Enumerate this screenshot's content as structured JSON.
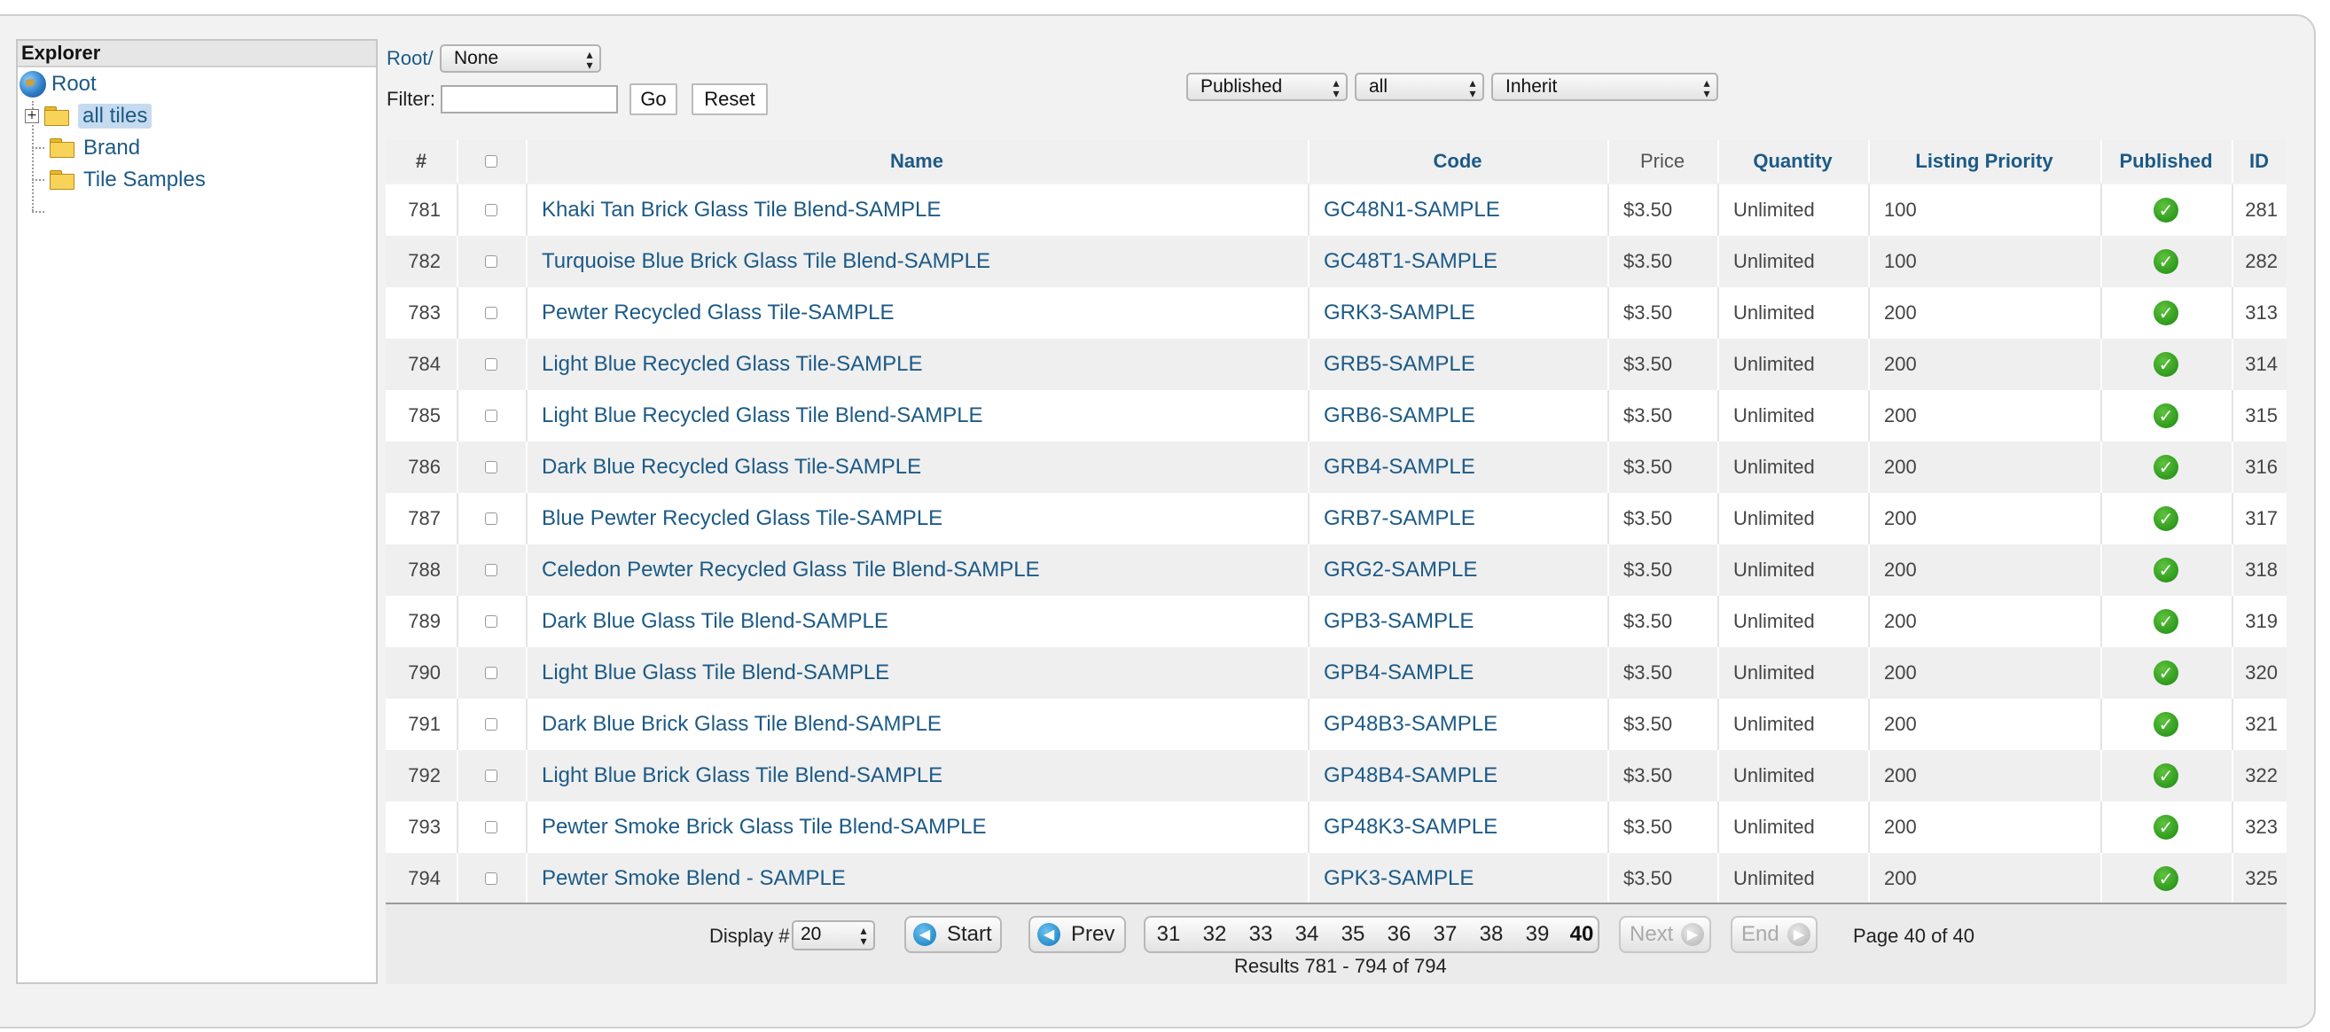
{
  "explorer": {
    "title": "Explorer",
    "root": "Root",
    "nodes": [
      "all tiles",
      "Brand",
      "Tile Samples"
    ]
  },
  "toolbar": {
    "root_link": "Root/",
    "parent_select": "None",
    "filter_label": "Filter:",
    "filter_value": "",
    "go_label": "Go",
    "reset_label": "Reset",
    "published_select": "Published",
    "all_select": "all",
    "inherit_select": "Inherit"
  },
  "table": {
    "headers": [
      "#",
      "",
      "Name",
      "Code",
      "Price",
      "Quantity",
      "Listing Priority",
      "Published",
      "ID"
    ],
    "rows": [
      {
        "num": "781",
        "name": "Khaki Tan Brick Glass Tile Blend-SAMPLE",
        "code": "GC48N1-SAMPLE",
        "price": "$3.50",
        "qty": "Unlimited",
        "priority": "100",
        "published": true,
        "id": "281"
      },
      {
        "num": "782",
        "name": "Turquoise Blue Brick Glass Tile Blend-SAMPLE",
        "code": "GC48T1-SAMPLE",
        "price": "$3.50",
        "qty": "Unlimited",
        "priority": "100",
        "published": true,
        "id": "282"
      },
      {
        "num": "783",
        "name": "Pewter Recycled Glass Tile-SAMPLE",
        "code": "GRK3-SAMPLE",
        "price": "$3.50",
        "qty": "Unlimited",
        "priority": "200",
        "published": true,
        "id": "313"
      },
      {
        "num": "784",
        "name": "Light Blue Recycled Glass Tile-SAMPLE",
        "code": "GRB5-SAMPLE",
        "price": "$3.50",
        "qty": "Unlimited",
        "priority": "200",
        "published": true,
        "id": "314"
      },
      {
        "num": "785",
        "name": "Light Blue Recycled Glass Tile Blend-SAMPLE",
        "code": "GRB6-SAMPLE",
        "price": "$3.50",
        "qty": "Unlimited",
        "priority": "200",
        "published": true,
        "id": "315"
      },
      {
        "num": "786",
        "name": "Dark Blue Recycled Glass Tile-SAMPLE",
        "code": "GRB4-SAMPLE",
        "price": "$3.50",
        "qty": "Unlimited",
        "priority": "200",
        "published": true,
        "id": "316"
      },
      {
        "num": "787",
        "name": "Blue Pewter Recycled Glass Tile-SAMPLE",
        "code": "GRB7-SAMPLE",
        "price": "$3.50",
        "qty": "Unlimited",
        "priority": "200",
        "published": true,
        "id": "317"
      },
      {
        "num": "788",
        "name": "Celedon Pewter Recycled Glass Tile Blend-SAMPLE",
        "code": "GRG2-SAMPLE",
        "price": "$3.50",
        "qty": "Unlimited",
        "priority": "200",
        "published": true,
        "id": "318"
      },
      {
        "num": "789",
        "name": "Dark Blue Glass Tile Blend-SAMPLE",
        "code": "GPB3-SAMPLE",
        "price": "$3.50",
        "qty": "Unlimited",
        "priority": "200",
        "published": true,
        "id": "319"
      },
      {
        "num": "790",
        "name": "Light Blue Glass Tile Blend-SAMPLE",
        "code": "GPB4-SAMPLE",
        "price": "$3.50",
        "qty": "Unlimited",
        "priority": "200",
        "published": true,
        "id": "320"
      },
      {
        "num": "791",
        "name": "Dark Blue Brick Glass Tile Blend-SAMPLE",
        "code": "GP48B3-SAMPLE",
        "price": "$3.50",
        "qty": "Unlimited",
        "priority": "200",
        "published": true,
        "id": "321"
      },
      {
        "num": "792",
        "name": "Light Blue Brick Glass Tile Blend-SAMPLE",
        "code": "GP48B4-SAMPLE",
        "price": "$3.50",
        "qty": "Unlimited",
        "priority": "200",
        "published": true,
        "id": "322"
      },
      {
        "num": "793",
        "name": "Pewter Smoke Brick Glass Tile Blend-SAMPLE",
        "code": "GP48K3-SAMPLE",
        "price": "$3.50",
        "qty": "Unlimited",
        "priority": "200",
        "published": true,
        "id": "323"
      },
      {
        "num": "794",
        "name": "Pewter Smoke Blend - SAMPLE",
        "code": "GPK3-SAMPLE",
        "price": "$3.50",
        "qty": "Unlimited",
        "priority": "200",
        "published": true,
        "id": "325"
      }
    ]
  },
  "pager": {
    "display_label": "Display #",
    "display_value": "20",
    "start_label": "Start",
    "prev_label": "Prev",
    "pages": [
      "31",
      "32",
      "33",
      "34",
      "35",
      "36",
      "37",
      "38",
      "39",
      "40"
    ],
    "current_page": "40",
    "next_label": "Next",
    "end_label": "End",
    "page_status": "Page 40 of 40",
    "results": "Results 781 - 794 of 794"
  },
  "colors": {
    "link": "#1c5a86",
    "published_check": "#2f9a1e",
    "row_alt": "#efefef"
  }
}
